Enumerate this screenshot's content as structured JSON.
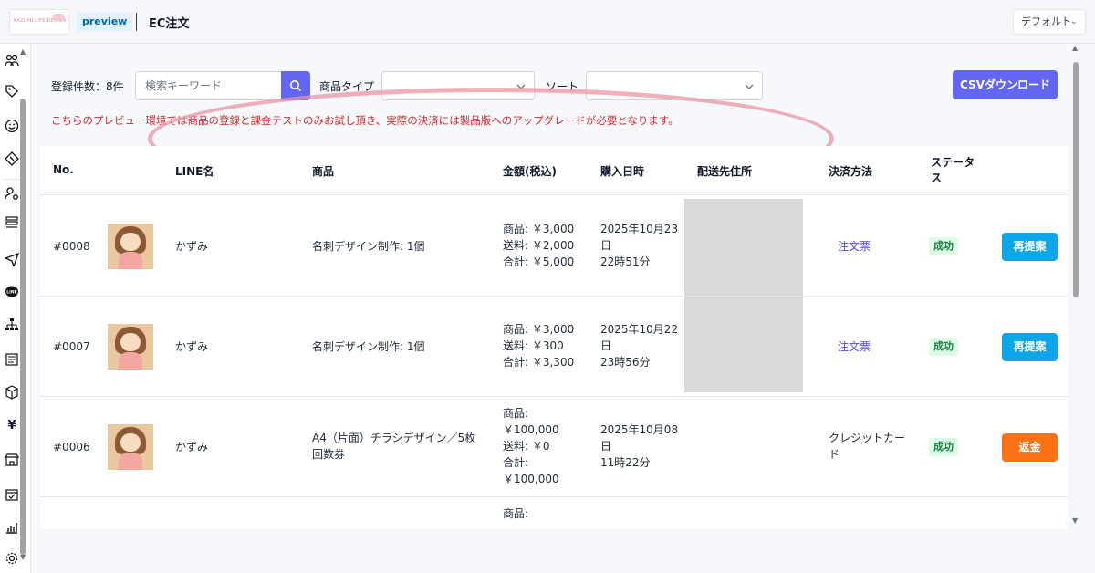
{
  "header": {
    "logo_text": "KAZUMI LIFE DESIGN",
    "preview_badge": "preview",
    "title": "EC注文",
    "view_select": "デフォルト"
  },
  "sidebar": {
    "icons": [
      "users-icon",
      "tag-icon",
      "smile-icon",
      "ticket-icon",
      "user-settings-icon",
      "list-icon",
      "send-icon",
      "line-icon",
      "org-chart-icon",
      "document-icon",
      "box-icon",
      "yen-icon",
      "store-icon",
      "calendar-check-icon",
      "bar-chart-icon",
      "gear-icon"
    ]
  },
  "filters": {
    "count_label": "登録件数：8件",
    "search_placeholder": "検索キーワード",
    "product_type_label": "商品タイプ",
    "product_type_value": "",
    "sort_label": "ソート",
    "sort_value": "",
    "csv_button": "CSVダウンロード"
  },
  "notice": "こちらのプレビュー環境では商品の登録と課金テストのみお試し頂き、実際の決済には製品版へのアップグレードが必要となります。",
  "table": {
    "headers": {
      "no": "No.",
      "line_name": "LINE名",
      "product": "商品",
      "amount": "金額(税込)",
      "purchase_date": "購入日時",
      "address": "配送先住所",
      "payment": "決済方法",
      "status_line1": "ステータ",
      "status_line2": "ス"
    },
    "rows": [
      {
        "no": "#0008",
        "line_name": "かずみ",
        "product": "名刺デザイン制作: 1個",
        "amount_product": "商品: ￥3,000",
        "amount_shipping": "送料: ￥2,000",
        "amount_total": "合計: ￥5,000",
        "date_line1": "2025年10月23",
        "date_line2": "日",
        "date_line3": "22時51分",
        "payment": "注文票",
        "status": "成功",
        "action": "再提案"
      },
      {
        "no": "#0007",
        "line_name": "かずみ",
        "product": "名刺デザイン制作: 1個",
        "amount_product": "商品: ￥3,000",
        "amount_shipping": "送料: ￥300",
        "amount_total": "合計: ￥3,300",
        "date_line1": "2025年10月22",
        "date_line2": "日",
        "date_line3": "23時56分",
        "payment": "注文票",
        "status": "成功",
        "action": "再提案"
      },
      {
        "no": "#0006",
        "line_name": "かずみ",
        "product_line1": "A4（片面）チラシデザイン／5枚",
        "product_line2": "回数券",
        "amount_line1": "商品:",
        "amount_line2": "￥100,000",
        "amount_line3": "送料: ￥0",
        "amount_line4": "合計:",
        "amount_line5": "￥100,000",
        "date_line1": "2025年10月08",
        "date_line2": "日",
        "date_line3": "11時22分",
        "payment_line1": "クレジットカー",
        "payment_line2": "ド",
        "status": "成功",
        "action": "返金"
      },
      {
        "amount_line1": "商品:"
      }
    ]
  }
}
